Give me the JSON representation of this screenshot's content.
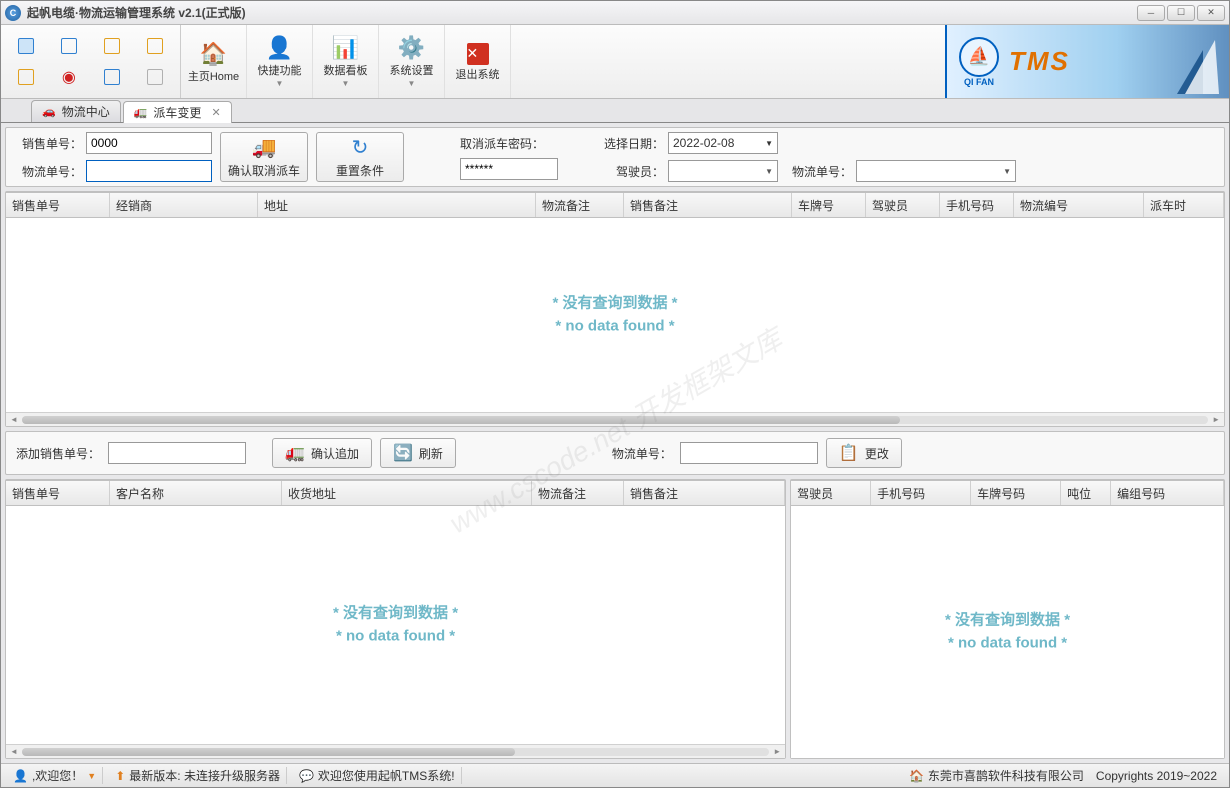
{
  "title": "起帆电缆·物流运输管理系统 v2.1(正式版)",
  "brand": {
    "logo_sub": "QI FAN",
    "tms": "TMS"
  },
  "ribbon": {
    "home": "主页Home",
    "quick": "快捷功能",
    "board": "数据看板",
    "settings": "系统设置",
    "exit": "退出系统"
  },
  "tabs": {
    "t1": "物流中心",
    "t2": "派车变更"
  },
  "filter": {
    "sales_no_label": "销售单号：",
    "sales_no_value": "0000",
    "logistics_no_label": "物流单号：",
    "logistics_no_value": "",
    "confirm_cancel": "确认取消派车",
    "reset": "重置条件",
    "cancel_pwd_label": "取消派车密码：",
    "cancel_pwd_value": "******",
    "date_label": "选择日期：",
    "date_value": "2022-02-08",
    "driver_label": "驾驶员：",
    "logistics2_label": "物流单号："
  },
  "grid1": {
    "cols": {
      "c1": "销售单号",
      "c2": "经销商",
      "c3": "地址",
      "c4": "物流备注",
      "c5": "销售备注",
      "c6": "车牌号",
      "c7": "驾驶员",
      "c8": "手机号码",
      "c9": "物流编号",
      "c10": "派车时"
    },
    "nodata1": "* 没有查询到数据 *",
    "nodata2": "* no data found *"
  },
  "mid": {
    "add_sales_label": "添加销售单号：",
    "add_confirm": "确认追加",
    "refresh": "刷新",
    "logistics_label": "物流单号：",
    "modify": "更改"
  },
  "grid2": {
    "cols": {
      "c1": "销售单号",
      "c2": "客户名称",
      "c3": "收货地址",
      "c4": "物流备注",
      "c5": "销售备注"
    },
    "nodata1": "* 没有查询到数据 *",
    "nodata2": "* no data found *"
  },
  "grid3": {
    "cols": {
      "c1": "驾驶员",
      "c2": "手机号码",
      "c3": "车牌号码",
      "c4": "吨位",
      "c5": "编组号码"
    },
    "nodata1": "* 没有查询到数据 *",
    "nodata2": "* no data found *"
  },
  "status": {
    "welcome": ",欢迎您！",
    "version_label": "最新版本: 未连接升级服务器",
    "welcome_msg": "欢迎您使用起帆TMS系统!",
    "company": "东莞市喜鹊软件科技有限公司",
    "copyright": "Copyrights 2019~2022"
  },
  "watermark": "www.cscode.net 开发框架文库"
}
